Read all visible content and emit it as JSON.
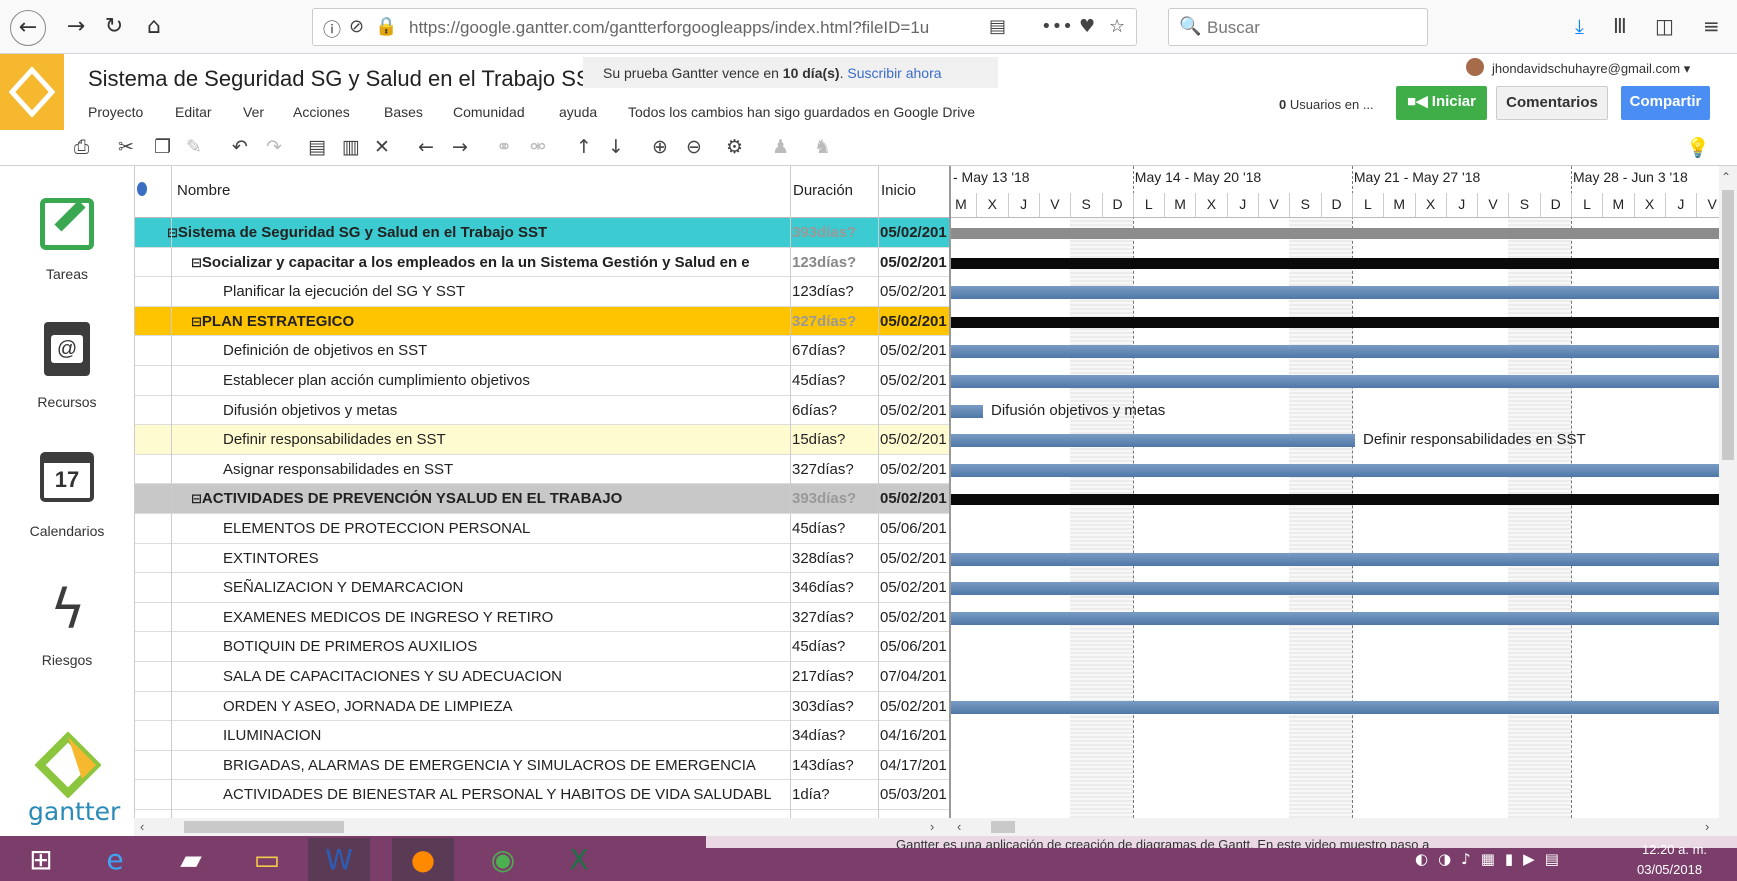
{
  "browser": {
    "url": "https://google.gantter.com/gantterforgoogleapps/index.html?fileID=1u",
    "search_placeholder": "Buscar"
  },
  "app": {
    "title": "Sistema de Seguridad SG y Salud en el Trabajo SST",
    "trial_text": "Su prueba Gantter vence en ",
    "trial_days": "10 día(s)",
    "trial_suffix": ". ",
    "trial_link": "Suscribir ahora",
    "menu": [
      "Proyecto",
      "Editar",
      "Ver",
      "Acciones",
      "Bases",
      "Comunidad",
      "ayuda"
    ],
    "save_status": "Todos los cambios han sigo guardados en Google Drive",
    "user_email": "jhondavidschuhayre@gmail.com",
    "users_online_count": "0",
    "users_online_label": " Usuarios en ...",
    "btn_iniciar": "Iniciar",
    "btn_comentarios": "Comentarios",
    "btn_compartir": "Compartir",
    "brand": "gantter"
  },
  "sidebar": [
    "Tareas",
    "Recursos",
    "Calendarios",
    "Riesgos"
  ],
  "calendar_icon_day": "17",
  "grid": {
    "col_name": "Nombre",
    "col_duration": "Duración",
    "col_start": "Inicio"
  },
  "tasks": [
    {
      "name": "Sistema de Seguridad SG y Salud en el Trabajo SST",
      "duration": "393días?",
      "start": "05/02/201",
      "level": 0,
      "summary": true,
      "highlight": "teal"
    },
    {
      "name": "Socializar y capacitar a los empleados en la un Sistema Gestión  y Salud en e",
      "duration": "123días?",
      "start": "05/02/201",
      "level": 1,
      "summary": true
    },
    {
      "name": "Planificar la ejecución del SG Y SST",
      "duration": "123días?",
      "start": "05/02/201",
      "level": 2
    },
    {
      "name": "PLAN ESTRATEGICO",
      "duration": "327días?",
      "start": "05/02/201",
      "level": 1,
      "summary": true,
      "highlight": "orange"
    },
    {
      "name": "Definición de objetivos en SST",
      "duration": "67días?",
      "start": "05/02/201",
      "level": 2
    },
    {
      "name": "Establecer plan acción cumplimiento objetivos",
      "duration": "45días?",
      "start": "05/02/201",
      "level": 2
    },
    {
      "name": "Difusión objetivos y metas",
      "duration": "6días?",
      "start": "05/02/201",
      "level": 2
    },
    {
      "name": "Definir responsabilidades en SST",
      "duration": "15días?",
      "start": "05/02/201",
      "level": 2,
      "highlight": "yellow"
    },
    {
      "name": "Asignar responsabilidades en SST",
      "duration": "327días?",
      "start": "05/02/201",
      "level": 2
    },
    {
      "name": "ACTIVIDADES DE PREVENCIÓN YSALUD EN EL TRABAJO",
      "duration": "393días?",
      "start": "05/02/201",
      "level": 1,
      "summary": true,
      "highlight": "grey"
    },
    {
      "name": "ELEMENTOS DE PROTECCION PERSONAL",
      "duration": "45días?",
      "start": "05/06/201",
      "level": 2
    },
    {
      "name": "EXTINTORES",
      "duration": "328días?",
      "start": "05/02/201",
      "level": 2
    },
    {
      "name": "SEÑALIZACION Y DEMARCACION",
      "duration": "346días?",
      "start": "05/02/201",
      "level": 2
    },
    {
      "name": "EXAMENES MEDICOS DE INGRESO Y RETIRO",
      "duration": "327días?",
      "start": "05/02/201",
      "level": 2
    },
    {
      "name": "BOTIQUIN DE PRIMEROS AUXILIOS",
      "duration": "45días?",
      "start": "05/06/201",
      "level": 2
    },
    {
      "name": "SALA DE CAPACITACIONES Y SU ADECUACION",
      "duration": "217días?",
      "start": "07/04/201",
      "level": 2
    },
    {
      "name": "ORDEN Y ASEO, JORNADA DE LIMPIEZA",
      "duration": "303días?",
      "start": "05/02/201",
      "level": 2
    },
    {
      "name": "ILUMINACION",
      "duration": "34días?",
      "start": "04/16/201",
      "level": 2
    },
    {
      "name": "BRIGADAS, ALARMAS DE EMERGENCIA Y SIMULACROS  DE EMERGENCIA",
      "duration": "143días?",
      "start": "04/17/201",
      "level": 2
    },
    {
      "name": "ACTIVIDADES DE BIENESTAR AL PERSONAL  Y HABITOS DE VIDA SALUDABLE",
      "duration": "1día?",
      "start": "05/03/201",
      "level": 2
    }
  ],
  "timeline": {
    "weeks": [
      "- May 13 '18",
      "May 14 - May 20 '18",
      "May 21 - May 27 '18",
      "May 28 - Jun 3 '18"
    ],
    "days": [
      "M",
      "X",
      "J",
      "V",
      "S",
      "D",
      "L",
      "M",
      "X",
      "J",
      "V",
      "S",
      "D",
      "L",
      "M",
      "X",
      "J",
      "V",
      "S",
      "D",
      "L",
      "M",
      "X",
      "J",
      "V"
    ],
    "bar_labels": {
      "6": "Difusión objetivos y metas",
      "7": "Definir responsabilidades en SST"
    }
  },
  "taskbar": {
    "video_text": "Gantter es una aplicación de creación de diagramas de Gantt. En este video muestro paso a",
    "time": "12:20 a. m.",
    "date": "03/05/2018"
  }
}
